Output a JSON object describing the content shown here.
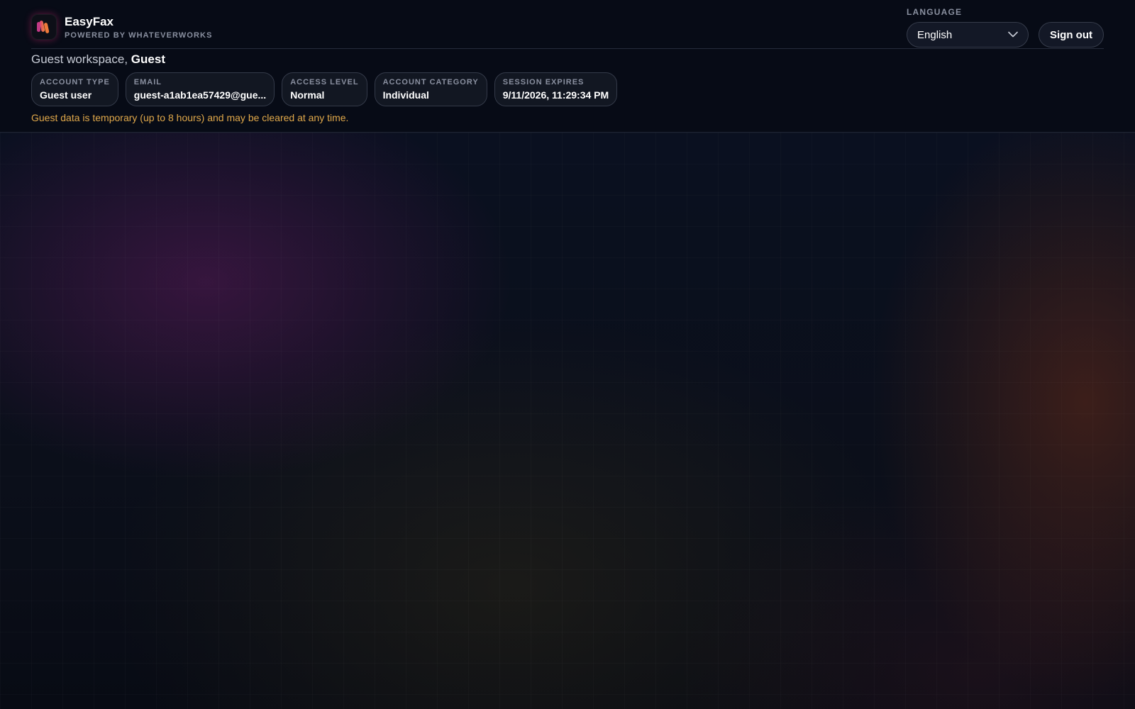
{
  "app": {
    "name": "EasyFax",
    "powered_by": "POWERED BY WHATEVERWORKS",
    "logo_icon": "brand-logo-icon"
  },
  "language": {
    "label": "LANGUAGE",
    "selected": "English",
    "icon": "chevron-down-icon"
  },
  "actions": {
    "sign_out": "Sign out"
  },
  "welcome": {
    "prefix": "Guest workspace,",
    "name": "Guest"
  },
  "account": {
    "items": [
      {
        "label": "ACCOUNT TYPE",
        "value": "Guest user"
      },
      {
        "label": "EMAIL",
        "value": "guest-a1ab1ea57429@gue..."
      },
      {
        "label": "ACCESS LEVEL",
        "value": "Normal"
      },
      {
        "label": "ACCOUNT CATEGORY",
        "value": "Individual"
      },
      {
        "label": "SESSION EXPIRES",
        "value": "9/11/2026, 11:29:34 PM"
      }
    ]
  },
  "notice": "Guest data is temporary (up to 8 hours) and may be cleared at any time.",
  "colors": {
    "background": "#070b16",
    "notice": "#e0a84a",
    "chip_border": "#343a49"
  }
}
